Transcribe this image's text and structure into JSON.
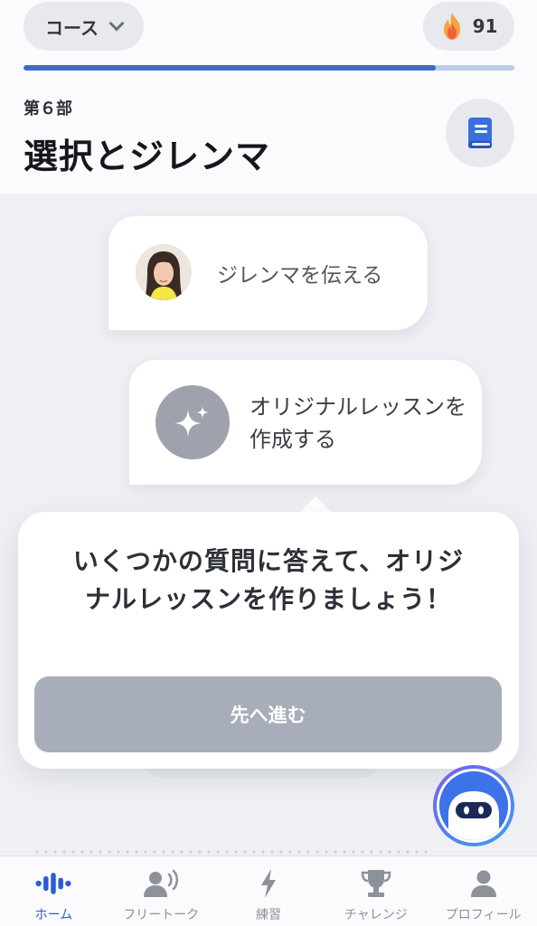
{
  "header": {
    "course_label": "コース",
    "streak_count": "91",
    "progress_fraction": 0.84,
    "part_label": "第６部",
    "unit_title": "選択とジレンマ"
  },
  "lessons": [
    {
      "label": "ジレンマを伝える",
      "icon": "avatar-photo"
    },
    {
      "label": "オリジナルレッスンを作成する",
      "icon": "sparkle-icon"
    }
  ],
  "tooltip": {
    "message": "いくつかの質問に答えて、オリジナルレッスンを作りましょう！",
    "button_label": "先へ進む"
  },
  "bottom_nav": [
    {
      "label": "ホーム",
      "icon": "voice-wave-icon",
      "active": true
    },
    {
      "label": "フリートーク",
      "icon": "speaking-person-icon",
      "active": false
    },
    {
      "label": "練習",
      "icon": "lightning-icon",
      "active": false
    },
    {
      "label": "チャレンジ",
      "icon": "trophy-icon",
      "active": false
    },
    {
      "label": "プロフィール",
      "icon": "person-icon",
      "active": false
    }
  ],
  "colors": {
    "accent": "#2d5bd7",
    "progress": "#3e6bc9",
    "button_disabled": "#a8aeb9",
    "streak_flame": "#f08a3a"
  }
}
